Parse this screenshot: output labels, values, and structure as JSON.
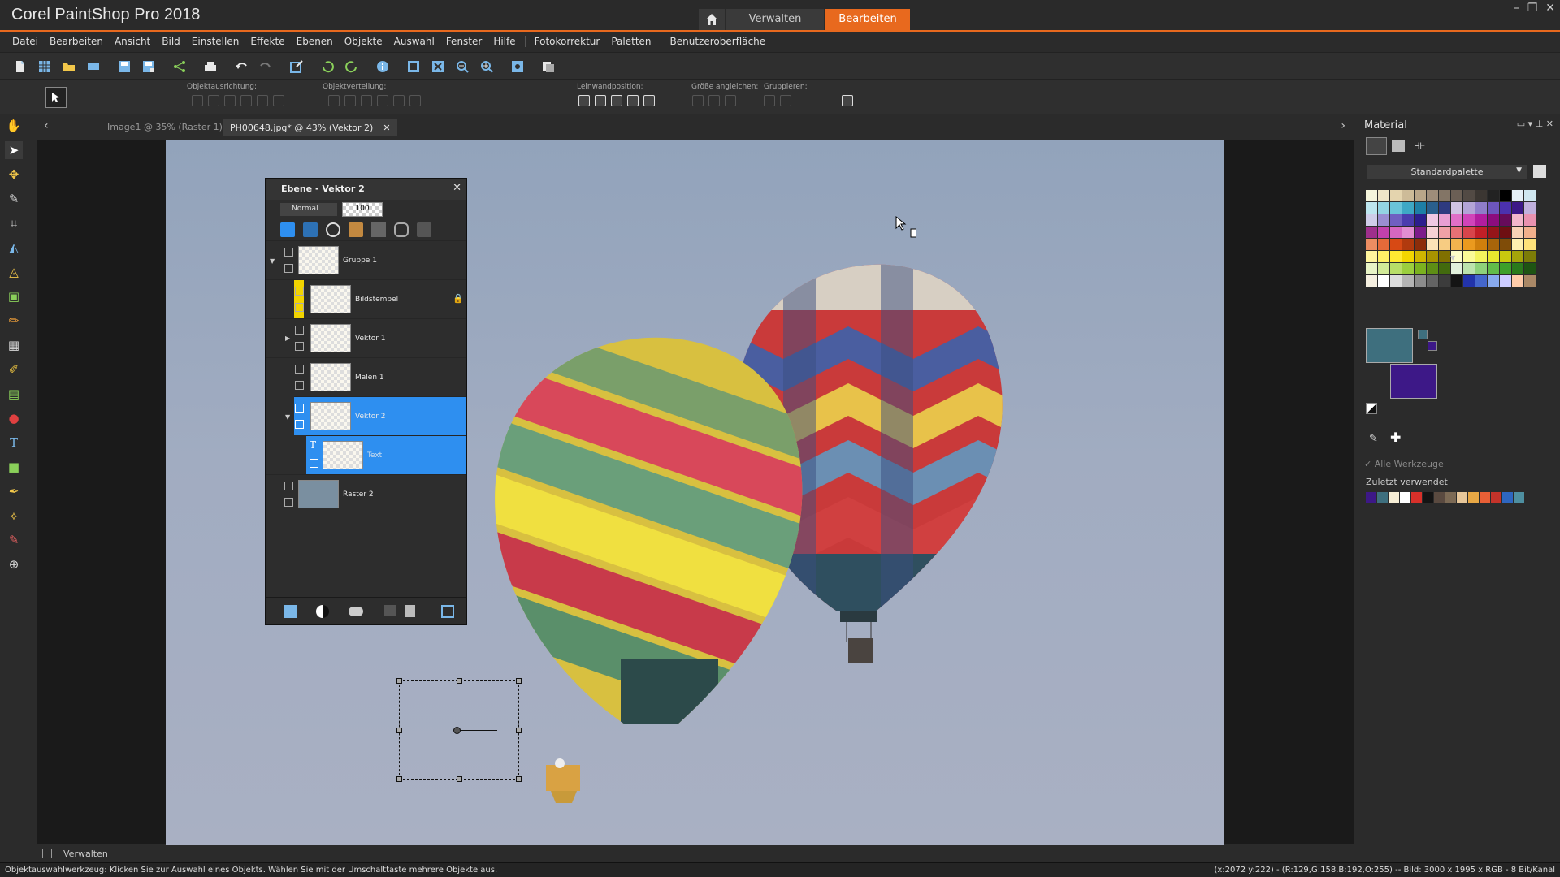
{
  "app": {
    "title": "Corel PaintShop Pro 2018"
  },
  "tabs": {
    "manage": "Verwalten",
    "edit": "Bearbeiten"
  },
  "menu": [
    "Datei",
    "Bearbeiten",
    "Ansicht",
    "Bild",
    "Einstellen",
    "Effekte",
    "Ebenen",
    "Objekte",
    "Auswahl",
    "Fenster",
    "Hilfe",
    "Fotokorrektur",
    "Paletten",
    "Benutzeroberfläche"
  ],
  "toolbar2": {
    "object_align": "Objektausrichtung:",
    "object_distribute": "Objektverteilung:",
    "canvas_position": "Leinwandposition:",
    "match_size": "Größe angleichen:",
    "group": "Gruppieren:"
  },
  "doc_tabs": {
    "tab1": "Image1 @  35% (Raster 1)",
    "tab2": "PH00648.jpg* @  43% (Vektor 2)"
  },
  "layers": {
    "title": "Ebene - Vektor 2",
    "blend_mode": "Normal",
    "opacity": "100",
    "items": [
      {
        "name": "Gruppe 1"
      },
      {
        "name": "Bildstempel"
      },
      {
        "name": "Vektor 1"
      },
      {
        "name": "Malen 1"
      },
      {
        "name": "Vektor 2"
      },
      {
        "name": "Text"
      },
      {
        "name": "Raster 2"
      }
    ]
  },
  "material": {
    "title": "Material",
    "palette": "Standardpalette",
    "all_tools": "Alle Werkzeuge",
    "recent_label": "Zuletzt verwendet",
    "foreground_color": "#3e6f7e",
    "background_color": "#3d1887",
    "swatch_colors": [
      "#f5f5dc",
      "#efe6c8",
      "#e4d4ae",
      "#cdbb98",
      "#b9a689",
      "#9e8d7a",
      "#837566",
      "#6b5f55",
      "#524a44",
      "#3b3632",
      "#222",
      "#000",
      "#e6f1f8",
      "#cfe7f0",
      "#bde6ef",
      "#93d4e2",
      "#6ac4d9",
      "#3ea8c5",
      "#1e7fa6",
      "#2a5f8d",
      "#2e3a80",
      "#d0c3e2",
      "#b3a4d6",
      "#8f7dc9",
      "#6d56bd",
      "#4b31ae",
      "#3d1887",
      "#c0b0dd",
      "#cfcde9",
      "#9a8ed1",
      "#6f5fc1",
      "#4b3cae",
      "#2c1e8e",
      "#f0c8e4",
      "#e89fd3",
      "#e06fc6",
      "#d044b9",
      "#b21d9f",
      "#8c0c7e",
      "#660b5a",
      "#f2b6cb",
      "#e992b0",
      "#9e2f8c",
      "#c241ac",
      "#d667c0",
      "#e28ed1",
      "#7c1c8a",
      "#f7d1d5",
      "#f0a1a6",
      "#e67075",
      "#d8454b",
      "#c11f27",
      "#961519",
      "#6e0f12",
      "#f8d2b5",
      "#f2b08c",
      "#ec8d62",
      "#e46a39",
      "#d74914",
      "#b13a0e",
      "#8c2d0a",
      "#fce3b7",
      "#f7cc82",
      "#f2b34e",
      "#eb9a1e",
      "#d07f0c",
      "#a8650a",
      "#7f4c08",
      "#fff0b0",
      "#ffe27a",
      "#fff59d",
      "#fff066",
      "#ffe932",
      "#f2d600",
      "#cfb600",
      "#a89300",
      "#807000",
      "#fefec8",
      "#fbfb96",
      "#f4f45c",
      "#e8e82e",
      "#c9c90f",
      "#a4a40a",
      "#7c7c07",
      "#e8f4c6",
      "#d2ea98",
      "#b8de68",
      "#9bcf3e",
      "#7bb21f",
      "#5e8e15",
      "#426a0e",
      "#e2f1dc",
      "#bce3ad",
      "#8ed17a",
      "#62bd4a",
      "#3d9f2a",
      "#2a7a1c",
      "#1e5413",
      "#f5efe0",
      "#ffffff",
      "#dcdcdc",
      "#b4b4b4",
      "#8c8c8c",
      "#646464",
      "#3c3c3c",
      "#141414",
      "#2233aa",
      "#4466cc",
      "#88aaee",
      "#ccccff",
      "#ffccaa",
      "#aa8866"
    ],
    "recent_colors": [
      "#3d1887",
      "#3e6f7e",
      "#f7eed6",
      "#ffffff",
      "#d7302a",
      "#141414",
      "#5a4a40",
      "#7c6a55",
      "#e7c79a",
      "#e8a845",
      "#e85f36",
      "#c4332a",
      "#2e66c0",
      "#4e8fa0"
    ]
  },
  "manager": "Verwalten",
  "status": {
    "left": "Objektauswahlwerkzeug: Klicken Sie zur Auswahl eines Objekts. Wählen Sie mit der Umschalttaste mehrere Objekte aus.",
    "right": "(x:2072 y:222) - (R:129,G:158,B:192,O:255) -- Bild:  3000 x 1995 x RGB - 8 Bit/Kanal"
  }
}
